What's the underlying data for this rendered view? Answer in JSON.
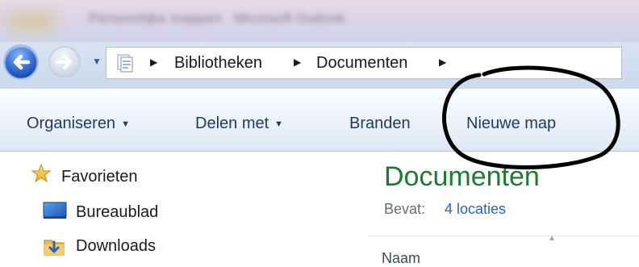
{
  "window": {
    "title_folder": "Persoonlijke mappen",
    "title_app": "Microsoft Outlook"
  },
  "address_bar": {
    "breadcrumbs": [
      {
        "label": "Bibliotheken"
      },
      {
        "label": "Documenten"
      }
    ],
    "separator_glyph": "▶"
  },
  "command_bar": {
    "organize_label": "Organiseren",
    "share_label": "Delen met",
    "burn_label": "Branden",
    "new_folder_label": "Nieuwe map",
    "dropdown_glyph": "▼"
  },
  "navigation_pane": {
    "favorites_label": "Favorieten",
    "items": [
      {
        "label": "Bureaublad",
        "icon": "desktop-icon"
      },
      {
        "label": "Downloads",
        "icon": "downloads-folder-icon"
      }
    ]
  },
  "content": {
    "library_title": "Documenten",
    "contains_label": "Bevat:",
    "locations_link": "4 locaties",
    "column_name_header": "Naam"
  },
  "colors": {
    "library_title": "#1e7a2f",
    "link": "#2a62c0",
    "command_text": "#1e3b61",
    "annotation": "#000000"
  }
}
